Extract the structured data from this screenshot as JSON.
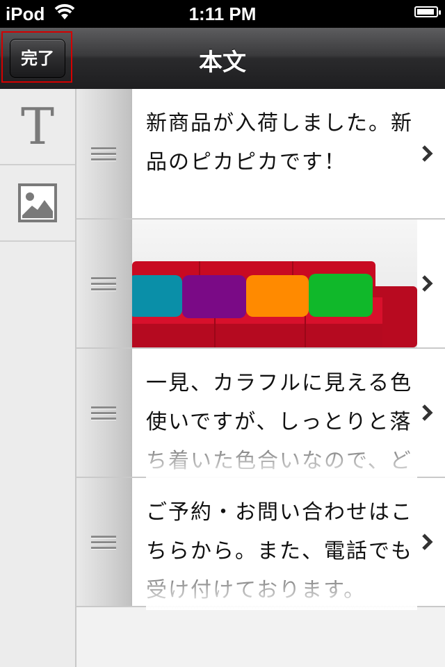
{
  "status_bar": {
    "carrier": "iPod",
    "time": "1:11 PM"
  },
  "nav": {
    "title": "本文",
    "done_label": "完了"
  },
  "tools": {
    "text_glyph": "T"
  },
  "rows": [
    {
      "type": "text",
      "text": "新商品が入荷しました。新品のピカピカです！"
    },
    {
      "type": "image",
      "description": "red sofa with colorful cushions"
    },
    {
      "type": "text",
      "text": "一見、カラフルに見える色使いですが、しっとりと落ち着いた色合いなので、ど"
    },
    {
      "type": "text",
      "text": "ご予約・お問い合わせはこちらから。また、電話でも受け付けております。"
    }
  ],
  "colors": {
    "highlight_border": "#d40000",
    "nav_dark": "#1e1e20",
    "sofa_red": "#d0102a"
  }
}
